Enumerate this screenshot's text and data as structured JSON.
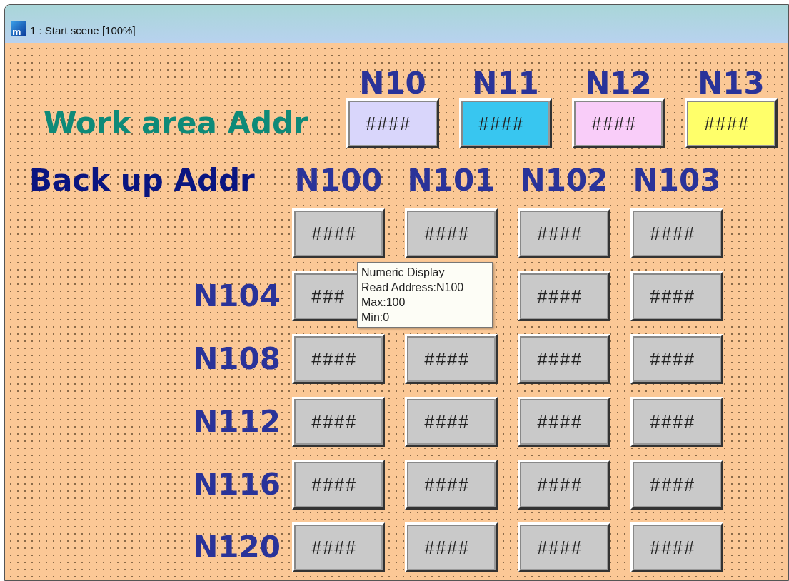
{
  "window": {
    "title": "1 : Start scene [100%]",
    "icon_letter": "m"
  },
  "work_area": {
    "label": "Work area Addr",
    "cells": [
      {
        "header": "N10",
        "value": "####",
        "color": "#d9d6fb"
      },
      {
        "header": "N11",
        "value": "####",
        "color": "#38c6f0"
      },
      {
        "header": "N12",
        "value": "####",
        "color": "#f9cdf9"
      },
      {
        "header": "N13",
        "value": "####",
        "color": "#ffff6a"
      }
    ]
  },
  "backup": {
    "label": "Back up Addr",
    "headers": [
      "N100",
      "N101",
      "N102",
      "N103"
    ],
    "rows": [
      {
        "cells": [
          "####",
          "####",
          "####",
          "####"
        ]
      },
      {
        "label": "N104",
        "cells": [
          "###",
          null,
          "####",
          "####"
        ]
      },
      {
        "label": "N108",
        "cells": [
          "####",
          "####",
          "####",
          "####"
        ]
      },
      {
        "label": "N112",
        "cells": [
          "####",
          "####",
          "####",
          "####"
        ]
      },
      {
        "label": "N116",
        "cells": [
          "####",
          "####",
          "####",
          "####"
        ]
      },
      {
        "label": "N120",
        "cells": [
          "####",
          "####",
          "####",
          "####"
        ]
      }
    ]
  },
  "tooltip": {
    "lines": [
      "Numeric Display",
      "Read Address:N100",
      "Max:100",
      "Min:0"
    ]
  }
}
